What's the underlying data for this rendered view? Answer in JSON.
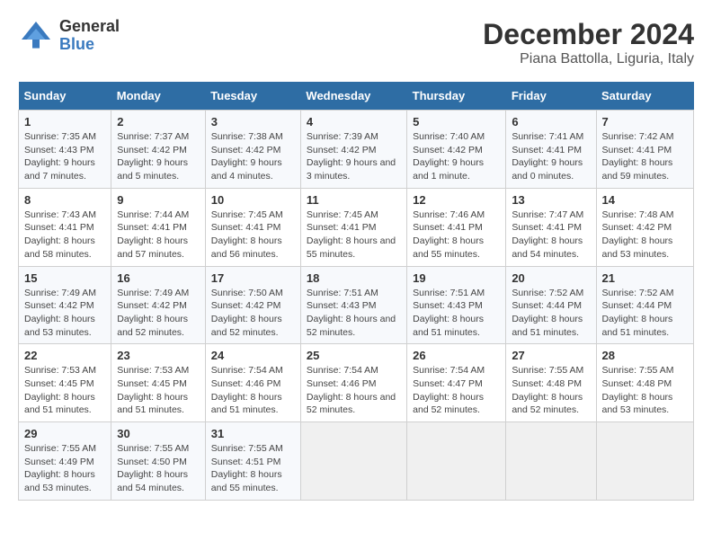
{
  "logo": {
    "general": "General",
    "blue": "Blue"
  },
  "title": "December 2024",
  "subtitle": "Piana Battolla, Liguria, Italy",
  "days_header": [
    "Sunday",
    "Monday",
    "Tuesday",
    "Wednesday",
    "Thursday",
    "Friday",
    "Saturday"
  ],
  "weeks": [
    [
      {
        "day": "1",
        "sunrise": "7:35 AM",
        "sunset": "4:43 PM",
        "daylight": "9 hours and 7 minutes."
      },
      {
        "day": "2",
        "sunrise": "7:37 AM",
        "sunset": "4:42 PM",
        "daylight": "9 hours and 5 minutes."
      },
      {
        "day": "3",
        "sunrise": "7:38 AM",
        "sunset": "4:42 PM",
        "daylight": "9 hours and 4 minutes."
      },
      {
        "day": "4",
        "sunrise": "7:39 AM",
        "sunset": "4:42 PM",
        "daylight": "9 hours and 3 minutes."
      },
      {
        "day": "5",
        "sunrise": "7:40 AM",
        "sunset": "4:42 PM",
        "daylight": "9 hours and 1 minute."
      },
      {
        "day": "6",
        "sunrise": "7:41 AM",
        "sunset": "4:41 PM",
        "daylight": "9 hours and 0 minutes."
      },
      {
        "day": "7",
        "sunrise": "7:42 AM",
        "sunset": "4:41 PM",
        "daylight": "8 hours and 59 minutes."
      }
    ],
    [
      {
        "day": "8",
        "sunrise": "7:43 AM",
        "sunset": "4:41 PM",
        "daylight": "8 hours and 58 minutes."
      },
      {
        "day": "9",
        "sunrise": "7:44 AM",
        "sunset": "4:41 PM",
        "daylight": "8 hours and 57 minutes."
      },
      {
        "day": "10",
        "sunrise": "7:45 AM",
        "sunset": "4:41 PM",
        "daylight": "8 hours and 56 minutes."
      },
      {
        "day": "11",
        "sunrise": "7:45 AM",
        "sunset": "4:41 PM",
        "daylight": "8 hours and 55 minutes."
      },
      {
        "day": "12",
        "sunrise": "7:46 AM",
        "sunset": "4:41 PM",
        "daylight": "8 hours and 55 minutes."
      },
      {
        "day": "13",
        "sunrise": "7:47 AM",
        "sunset": "4:41 PM",
        "daylight": "8 hours and 54 minutes."
      },
      {
        "day": "14",
        "sunrise": "7:48 AM",
        "sunset": "4:42 PM",
        "daylight": "8 hours and 53 minutes."
      }
    ],
    [
      {
        "day": "15",
        "sunrise": "7:49 AM",
        "sunset": "4:42 PM",
        "daylight": "8 hours and 53 minutes."
      },
      {
        "day": "16",
        "sunrise": "7:49 AM",
        "sunset": "4:42 PM",
        "daylight": "8 hours and 52 minutes."
      },
      {
        "day": "17",
        "sunrise": "7:50 AM",
        "sunset": "4:42 PM",
        "daylight": "8 hours and 52 minutes."
      },
      {
        "day": "18",
        "sunrise": "7:51 AM",
        "sunset": "4:43 PM",
        "daylight": "8 hours and 52 minutes."
      },
      {
        "day": "19",
        "sunrise": "7:51 AM",
        "sunset": "4:43 PM",
        "daylight": "8 hours and 51 minutes."
      },
      {
        "day": "20",
        "sunrise": "7:52 AM",
        "sunset": "4:44 PM",
        "daylight": "8 hours and 51 minutes."
      },
      {
        "day": "21",
        "sunrise": "7:52 AM",
        "sunset": "4:44 PM",
        "daylight": "8 hours and 51 minutes."
      }
    ],
    [
      {
        "day": "22",
        "sunrise": "7:53 AM",
        "sunset": "4:45 PM",
        "daylight": "8 hours and 51 minutes."
      },
      {
        "day": "23",
        "sunrise": "7:53 AM",
        "sunset": "4:45 PM",
        "daylight": "8 hours and 51 minutes."
      },
      {
        "day": "24",
        "sunrise": "7:54 AM",
        "sunset": "4:46 PM",
        "daylight": "8 hours and 51 minutes."
      },
      {
        "day": "25",
        "sunrise": "7:54 AM",
        "sunset": "4:46 PM",
        "daylight": "8 hours and 52 minutes."
      },
      {
        "day": "26",
        "sunrise": "7:54 AM",
        "sunset": "4:47 PM",
        "daylight": "8 hours and 52 minutes."
      },
      {
        "day": "27",
        "sunrise": "7:55 AM",
        "sunset": "4:48 PM",
        "daylight": "8 hours and 52 minutes."
      },
      {
        "day": "28",
        "sunrise": "7:55 AM",
        "sunset": "4:48 PM",
        "daylight": "8 hours and 53 minutes."
      }
    ],
    [
      {
        "day": "29",
        "sunrise": "7:55 AM",
        "sunset": "4:49 PM",
        "daylight": "8 hours and 53 minutes."
      },
      {
        "day": "30",
        "sunrise": "7:55 AM",
        "sunset": "4:50 PM",
        "daylight": "8 hours and 54 minutes."
      },
      {
        "day": "31",
        "sunrise": "7:55 AM",
        "sunset": "4:51 PM",
        "daylight": "8 hours and 55 minutes."
      },
      null,
      null,
      null,
      null
    ]
  ],
  "labels": {
    "sunrise": "Sunrise:",
    "sunset": "Sunset:",
    "daylight": "Daylight:"
  }
}
